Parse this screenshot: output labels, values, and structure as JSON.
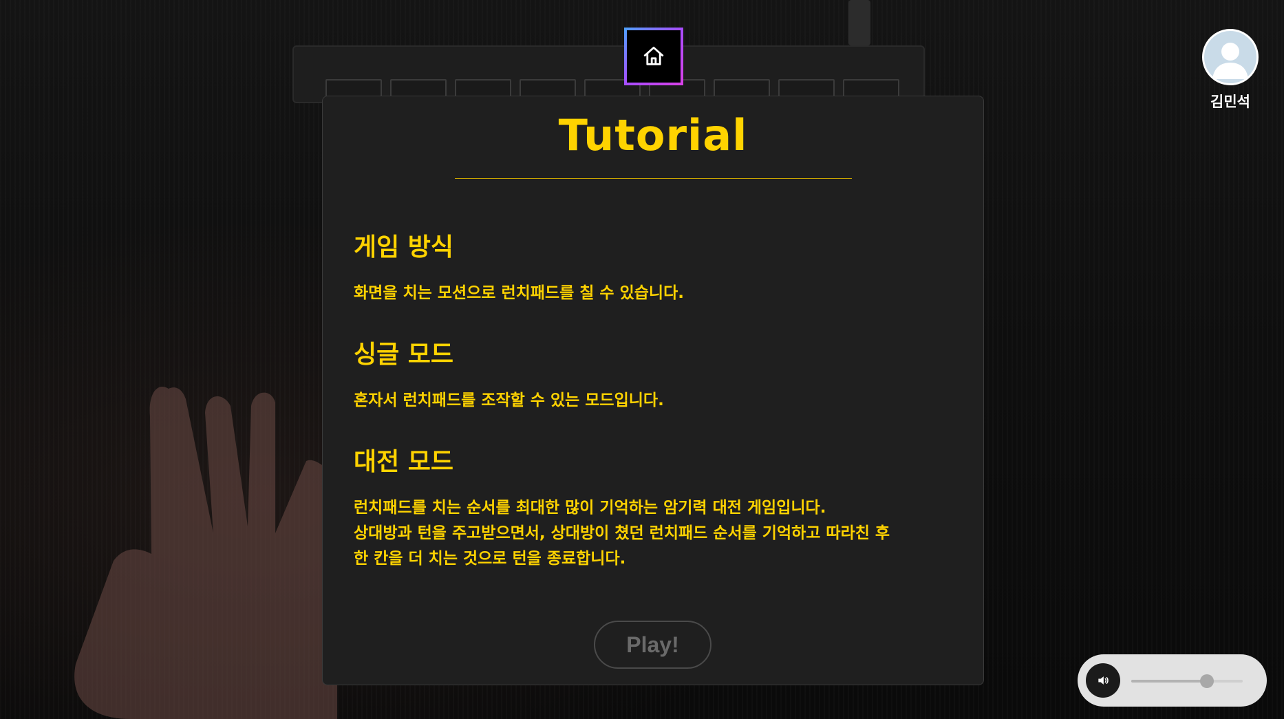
{
  "home": {
    "icon": "home-icon"
  },
  "tutorial": {
    "title": "Tutorial",
    "sections": [
      {
        "heading": "게임 방식",
        "body": [
          "화면을 치는 모션으로 런치패드를 칠 수 있습니다."
        ]
      },
      {
        "heading": "싱글 모드",
        "body": [
          "혼자서 런치패드를 조작할 수 있는 모드입니다."
        ]
      },
      {
        "heading": "대전 모드",
        "body": [
          "런치패드를 치는 순서를 최대한 많이 기억하는 암기력 대전 게임입니다.",
          "상대방과 턴을 주고받으면서, 상대방이 쳤던 런치패드 순서를 기억하고 따라친 후",
          "한 칸을 더 치는 것으로 턴을 종료합니다."
        ]
      }
    ],
    "play_label": "Play!"
  },
  "profile": {
    "name": "김민석",
    "icon": "avatar-icon"
  },
  "volume": {
    "icon": "speaker-icon",
    "level": 0.68
  },
  "colors": {
    "accent": "#ffd300",
    "card_bg": "#1f1f1f",
    "home_border_start": "#4da3ff",
    "home_border_end": "#d940e6"
  }
}
